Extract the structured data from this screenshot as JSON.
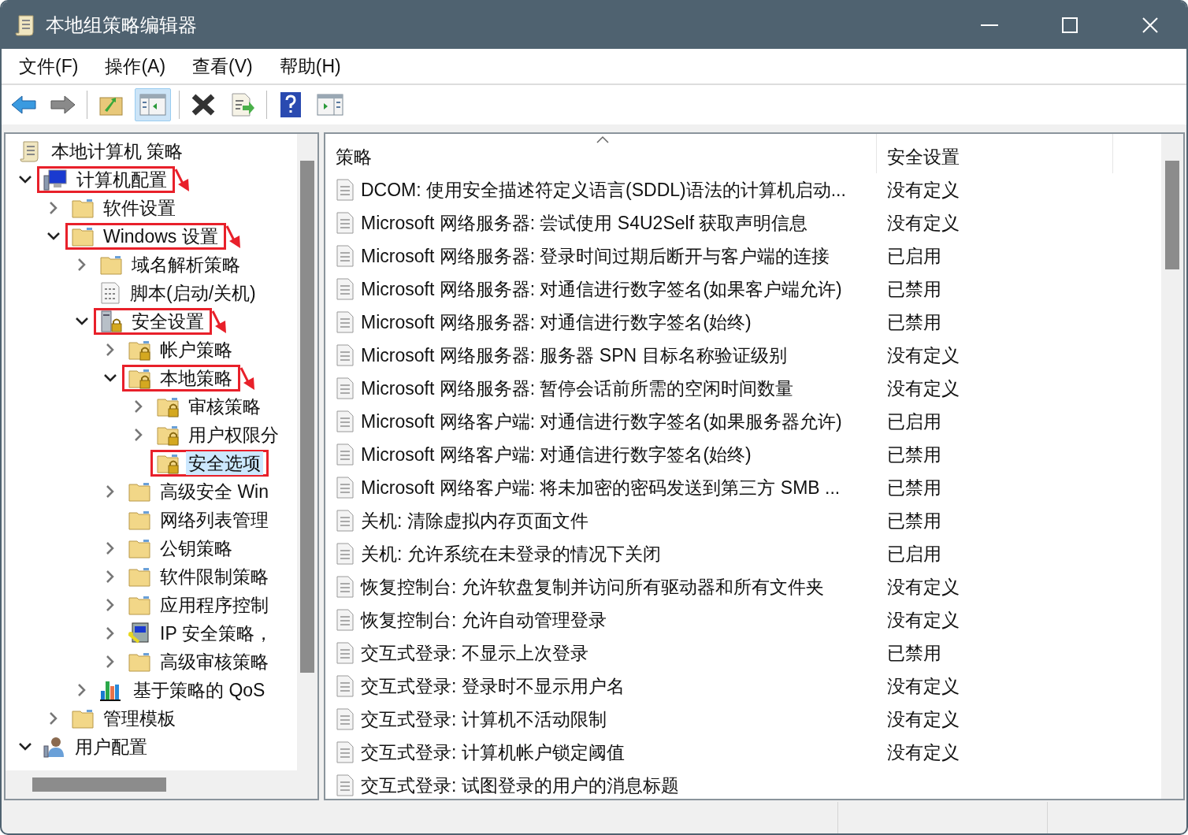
{
  "window": {
    "title": "本地组策略编辑器"
  },
  "menu": [
    "文件(F)",
    "操作(A)",
    "查看(V)",
    "帮助(H)"
  ],
  "toolbar": [
    {
      "kind": "back",
      "pressed": false
    },
    {
      "kind": "forward",
      "pressed": false
    },
    {
      "kind": "separator"
    },
    {
      "kind": "up",
      "pressed": false
    },
    {
      "kind": "tree",
      "pressed": true
    },
    {
      "kind": "separator"
    },
    {
      "kind": "delete",
      "pressed": false
    },
    {
      "kind": "export",
      "pressed": false
    },
    {
      "kind": "separator"
    },
    {
      "kind": "help",
      "pressed": false
    },
    {
      "kind": "action-pane",
      "pressed": false
    }
  ],
  "tree": {
    "root": "本地计算机 策略",
    "items": [
      {
        "label": "计算机配置",
        "kind": "computer",
        "expanded": true,
        "highlighted": true,
        "arrow": true,
        "children": [
          {
            "label": "软件设置",
            "kind": "folder",
            "expanded": false
          },
          {
            "label": "Windows 设置",
            "kind": "folder",
            "expanded": true,
            "highlighted": true,
            "arrow": true,
            "children": [
              {
                "label": "域名解析策略",
                "kind": "folder",
                "expanded": false
              },
              {
                "label": "脚本(启动/关机)",
                "kind": "script"
              },
              {
                "label": "安全设置",
                "kind": "server-lock",
                "expanded": true,
                "highlighted": true,
                "arrow": true,
                "children": [
                  {
                    "label": "帐户策略",
                    "kind": "locked-folder",
                    "expanded": false
                  },
                  {
                    "label": "本地策略",
                    "kind": "locked-folder",
                    "expanded": true,
                    "highlighted": true,
                    "arrow": true,
                    "children": [
                      {
                        "label": "审核策略",
                        "kind": "locked-folder",
                        "expanded": false
                      },
                      {
                        "label": "用户权限分",
                        "kind": "locked-folder",
                        "expanded": false
                      },
                      {
                        "label": "安全选项",
                        "kind": "locked-folder",
                        "selected": true,
                        "highlighted": true
                      }
                    ]
                  },
                  {
                    "label": "高级安全 Win",
                    "kind": "folder",
                    "expanded": false
                  },
                  {
                    "label": "网络列表管理",
                    "kind": "folder"
                  },
                  {
                    "label": "公钥策略",
                    "kind": "folder",
                    "expanded": false
                  },
                  {
                    "label": "软件限制策略",
                    "kind": "folder",
                    "expanded": false
                  },
                  {
                    "label": "应用程序控制",
                    "kind": "folder",
                    "expanded": false
                  },
                  {
                    "label": "IP 安全策略，",
                    "kind": "ip-policy",
                    "expanded": false
                  },
                  {
                    "label": "高级审核策略",
                    "kind": "folder",
                    "expanded": false
                  }
                ]
              },
              {
                "label": "基于策略的 QoS",
                "kind": "chart",
                "expanded": false
              }
            ]
          },
          {
            "label": "管理模板",
            "kind": "folder",
            "expanded": false
          }
        ]
      },
      {
        "label": "用户配置",
        "kind": "user",
        "expanded": true
      }
    ]
  },
  "table": {
    "columns": [
      "策略",
      "安全设置"
    ],
    "rows": [
      {
        "policy": "DCOM: 使用安全描述符定义语言(SDDL)语法的计算机启动...",
        "setting": "没有定义"
      },
      {
        "policy": "Microsoft 网络服务器: 尝试使用 S4U2Self 获取声明信息",
        "setting": "没有定义"
      },
      {
        "policy": "Microsoft 网络服务器: 登录时间过期后断开与客户端的连接",
        "setting": "已启用"
      },
      {
        "policy": "Microsoft 网络服务器: 对通信进行数字签名(如果客户端允许)",
        "setting": "已禁用"
      },
      {
        "policy": "Microsoft 网络服务器: 对通信进行数字签名(始终)",
        "setting": "已禁用"
      },
      {
        "policy": "Microsoft 网络服务器: 服务器 SPN 目标名称验证级别",
        "setting": "没有定义"
      },
      {
        "policy": "Microsoft 网络服务器: 暂停会话前所需的空闲时间数量",
        "setting": "没有定义"
      },
      {
        "policy": "Microsoft 网络客户端: 对通信进行数字签名(如果服务器允许)",
        "setting": "已启用"
      },
      {
        "policy": "Microsoft 网络客户端: 对通信进行数字签名(始终)",
        "setting": "已禁用"
      },
      {
        "policy": "Microsoft 网络客户端: 将未加密的密码发送到第三方 SMB ...",
        "setting": "已禁用"
      },
      {
        "policy": "关机: 清除虚拟内存页面文件",
        "setting": "已禁用"
      },
      {
        "policy": "关机: 允许系统在未登录的情况下关闭",
        "setting": "已启用"
      },
      {
        "policy": "恢复控制台: 允许软盘复制并访问所有驱动器和所有文件夹",
        "setting": "没有定义"
      },
      {
        "policy": "恢复控制台: 允许自动管理登录",
        "setting": "没有定义"
      },
      {
        "policy": "交互式登录: 不显示上次登录",
        "setting": "已禁用"
      },
      {
        "policy": "交互式登录: 登录时不显示用户名",
        "setting": "没有定义"
      },
      {
        "policy": "交互式登录: 计算机不活动限制",
        "setting": "没有定义"
      },
      {
        "policy": "交互式登录: 计算机帐户锁定阈值",
        "setting": "没有定义"
      },
      {
        "policy": "交互式登录: 试图登录的用户的消息标题"
      }
    ]
  }
}
